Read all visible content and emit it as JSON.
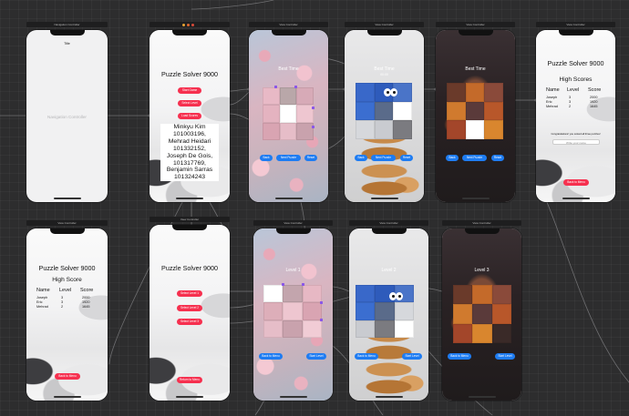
{
  "canvas": {
    "background": "#2d2d2e",
    "accent_button": "#f6304f",
    "blue_button": "#1e7cf2",
    "handle_color": "#8a57e8"
  },
  "scenes": {
    "nav": {
      "title": "Navigation Controller",
      "nav_title": "Title",
      "center_label": "Navigation Controller"
    },
    "menu": {
      "title": "Puzzle Solver 9000",
      "start_label": "Start Game",
      "level_label": "Select Level",
      "scores_label": "Load Scores",
      "credits": [
        "Minkyu Kim",
        "101003196,",
        "Mehrad Heidari",
        "101332152,",
        "Joseph De Gois,",
        "101317769,",
        "Benjamin Sarras",
        "101324243"
      ]
    },
    "g1": {
      "title": "View Controller",
      "timer": "Best Time",
      "back_label": "Back",
      "next_label": "Next Puzzle",
      "reset_label": "Reset"
    },
    "g2": {
      "title": "View Controller",
      "timer": "Best Time",
      "sub": "00:00",
      "back_label": "Back",
      "next_label": "Next Puzzle",
      "reset_label": "Reset"
    },
    "g3": {
      "title": "View Controller",
      "timer": "Best Time",
      "back_label": "Back",
      "next_label": "Next Puzzle",
      "reset_label": "Reset"
    },
    "win": {
      "title": "View Controller",
      "app_title": "Puzzle Solver 9000",
      "subtitle": "High Scores",
      "headers": [
        "Name",
        "Level",
        "Score"
      ],
      "rows": [
        [
          "Joseph",
          "3",
          "2000"
        ],
        [
          "Eric",
          "3",
          "1920"
        ],
        [
          "Mehrad",
          "2",
          "1645"
        ]
      ],
      "congrats": "Congratulations! you solved all three puzzles!",
      "name_placeholder": "Write your name",
      "back_label": "Back to Menu"
    },
    "hs": {
      "title": "View Controller",
      "app_title": "Puzzle Solver 9000",
      "subtitle": "High Score",
      "headers": [
        "Name",
        "Level",
        "Score"
      ],
      "rows": [
        [
          "Joseph",
          "3",
          "2000"
        ],
        [
          "Eric",
          "3",
          "1920"
        ],
        [
          "Mehrad",
          "2",
          "1645"
        ]
      ],
      "back_label": "Back to Menu"
    },
    "sel": {
      "title": "View Controller",
      "app_title": "Puzzle Solver 9000",
      "lvl1_label": "Select Level 1",
      "lvl2_label": "Select Level 2",
      "lvl3_label": "Select Level 3",
      "back_label": "Return to Menu"
    },
    "l1": {
      "title": "View Controller",
      "level": "Level 1",
      "back_label": "Back to Menu",
      "start_label": "Start Level"
    },
    "l2": {
      "title": "View Controller",
      "level": "Level 2",
      "back_label": "Back to Menu",
      "start_label": "Start Level"
    },
    "l3": {
      "title": "View Controller",
      "level": "Level 3",
      "back_label": "Back to Menu",
      "start_label": "Start Level"
    }
  }
}
